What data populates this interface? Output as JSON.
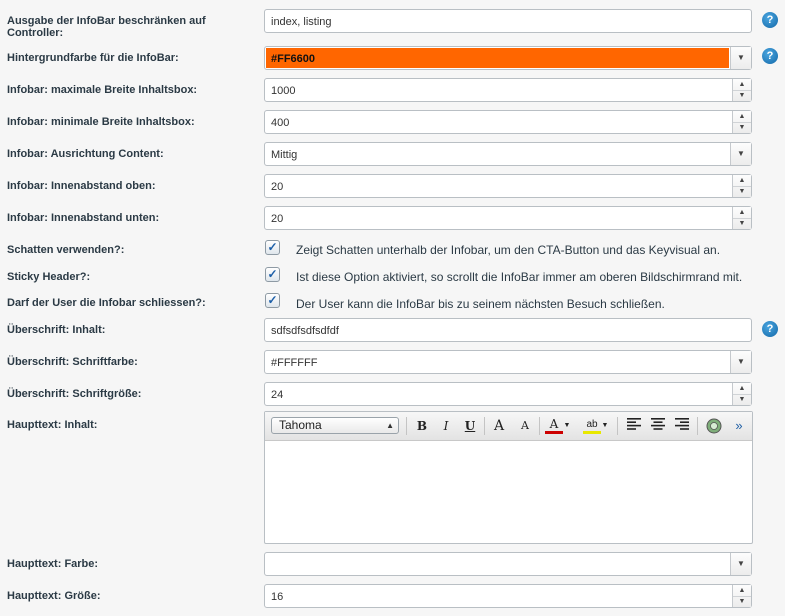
{
  "rows": {
    "controller": {
      "label": "Ausgabe der InfoBar beschränken auf Controller:",
      "value": "index, listing"
    },
    "bgcolor": {
      "label": "Hintergrundfarbe für die InfoBar:",
      "value": "#FF6600",
      "swatch": "#FF6600"
    },
    "maxwidth": {
      "label": "Infobar: maximale Breite Inhaltsbox:",
      "value": "1000"
    },
    "minwidth": {
      "label": "Infobar: minimale Breite Inhaltsbox:",
      "value": "400"
    },
    "align": {
      "label": "Infobar: Ausrichtung Content:",
      "value": "Mittig"
    },
    "padtop": {
      "label": "Infobar: Innenabstand oben:",
      "value": "20"
    },
    "padbottom": {
      "label": "Infobar: Innenabstand unten:",
      "value": "20"
    },
    "shadow": {
      "label": "Schatten verwenden?:",
      "text": "Zeigt Schatten unterhalb der Infobar, um den CTA-Button und das Keyvisual an.",
      "checked": true
    },
    "sticky": {
      "label": "Sticky Header?:",
      "text": "Ist diese Option aktiviert, so scrollt die InfoBar immer am oberen Bildschirmrand mit.",
      "checked": true
    },
    "closable": {
      "label": "Darf der User die Infobar schliessen?:",
      "text": "Der User kann die InfoBar bis zu seinem nächsten Besuch schließen.",
      "checked": true
    },
    "headline": {
      "label": "Überschrift: Inhalt:",
      "value": "sdfsdfsdfsdfdf"
    },
    "headcolor": {
      "label": "Überschrift: Schriftfarbe:",
      "value": "#FFFFFF"
    },
    "headsize": {
      "label": "Überschrift: Schriftgröße:",
      "value": "24"
    },
    "maintext": {
      "label": "Haupttext: Inhalt:",
      "font": "Tahoma"
    },
    "maincolor": {
      "label": "Haupttext: Farbe:",
      "value": ""
    },
    "mainsize": {
      "label": "Haupttext: Größe:",
      "value": "16"
    }
  },
  "help": "?",
  "checkmark": "✓",
  "toolbar": {
    "bold": "B",
    "italic": "I",
    "underline": "U",
    "grow": "A",
    "shrink": "A",
    "fontcolor": "A",
    "highlight": "ab",
    "more": "»"
  },
  "colors": {
    "accent": "#FF6600",
    "help": "#1b78c2",
    "label": "#2b3a45"
  },
  "icons": [
    "help-icon",
    "spin-up-icon",
    "spin-down-icon",
    "dropdown-arrow-icon",
    "checkmark-icon",
    "align-left-icon",
    "align-center-icon",
    "align-right-icon",
    "image-icon"
  ]
}
